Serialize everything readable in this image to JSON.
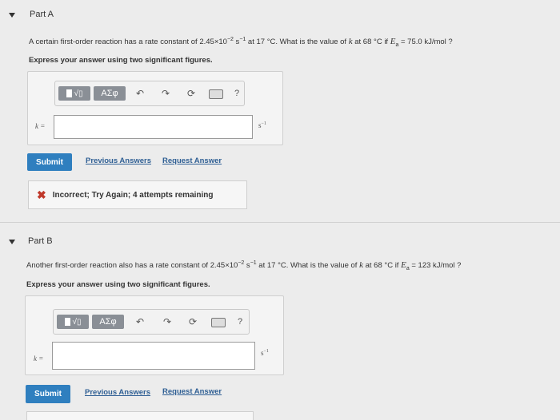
{
  "partA": {
    "title": "Part A",
    "question": {
      "p1": "A certain first-order reaction has a rate constant of 2.45×10",
      "exp1": "−2",
      "p2": " s",
      "exp2": "−1",
      "p3": " at 17 °C. What is the value of ",
      "k": "k",
      "p4": " at 68 °C if ",
      "ea": "E",
      "ea_sub": "a",
      "p5": " = 75.0 kJ/mol ?"
    },
    "instruction": "Express your answer using two significant figures.",
    "input_label": "k =",
    "unit": "s",
    "unit_exp": "−1",
    "submit": "Submit",
    "previous_answers": "Previous Answers",
    "request_answer": "Request Answer",
    "feedback": "Incorrect; Try Again; 4 attempts remaining"
  },
  "partB": {
    "title": "Part B",
    "question": {
      "p1": "Another first-order reaction also has a rate constant of 2.45×10",
      "exp1": "−2",
      "p2": " s",
      "exp2": "−1",
      "p3": " at 17 °C. What is the value of ",
      "k": "k",
      "p4": " at 68 °C if ",
      "ea": "E",
      "ea_sub": "a",
      "p5": " = 123 kJ/mol ?"
    },
    "instruction": "Express your answer using two significant figures.",
    "input_label": "k =",
    "unit": "s",
    "unit_exp": "−1",
    "submit": "Submit",
    "previous_answers": "Previous Answers",
    "request_answer": "Request Answer"
  },
  "toolbar": {
    "greek_label": "ΑΣφ",
    "help_label": "?"
  },
  "icons": {
    "template": "template-sqrt-icon",
    "undo": "undo-icon",
    "redo": "redo-icon",
    "reset": "reset-icon",
    "keyboard": "keyboard-icon",
    "incorrect": "x-mark-icon"
  },
  "colors": {
    "submit": "#2f7fbf",
    "link": "#2f5f94",
    "incorrect": "#c0392b"
  }
}
